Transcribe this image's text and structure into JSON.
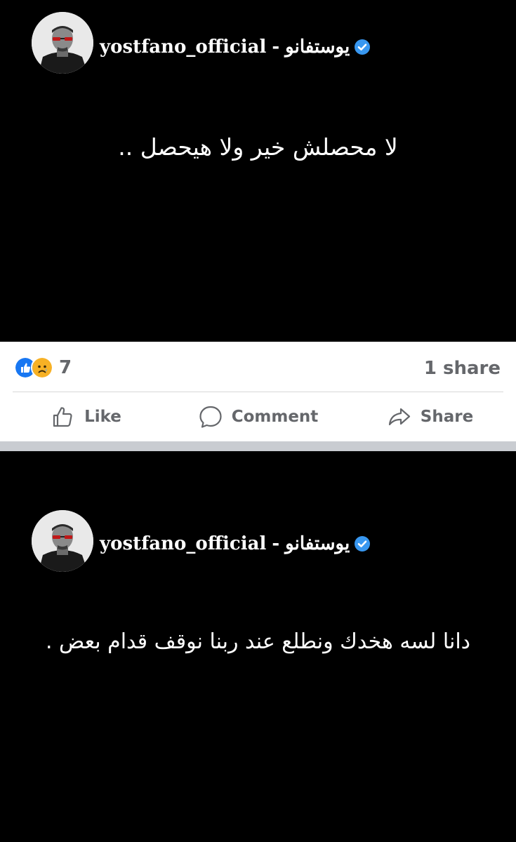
{
  "posts": [
    {
      "author": {
        "username": "yostfano_official",
        "separator": "-",
        "name_ar": "يوستفانو",
        "verified": true
      },
      "text": "لا محصلش خير ولا هيحصل .."
    },
    {
      "author": {
        "username": "yostfano_official",
        "separator": "-",
        "name_ar": "يوستفانو",
        "verified": true
      },
      "text": "دانا لسه هخدك ونطلع عند ربنا نوقف قدام بعض ."
    }
  ],
  "engagement": {
    "reactions": [
      "like-icon",
      "sad-icon"
    ],
    "reaction_count": "7",
    "share_count": "1 share"
  },
  "actions": {
    "like": "Like",
    "comment": "Comment",
    "share": "Share"
  },
  "colors": {
    "accent": "#1877f2",
    "text_muted": "#65676b",
    "verified": "#3897f0"
  }
}
